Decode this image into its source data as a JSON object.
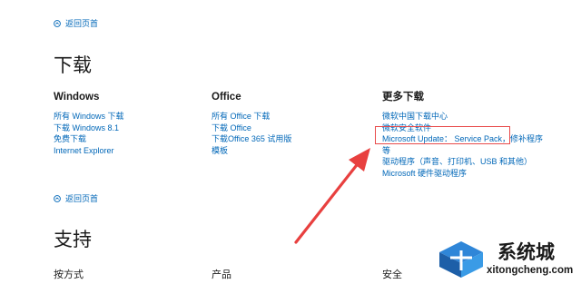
{
  "back_to_top_label": "返回页首",
  "download": {
    "heading": "下载",
    "columns": [
      {
        "title": "Windows",
        "links": [
          "所有 Windows 下载",
          "下载 Windows 8.1",
          "免费下载",
          "Internet Explorer"
        ]
      },
      {
        "title": "Office",
        "links": [
          "所有 Office 下载",
          "下载 Office",
          "下载Office 365 试用版",
          "模板"
        ]
      },
      {
        "title": "更多下载",
        "links": [
          "微软中国下载中心",
          "微软安全软件",
          "Microsoft Update： Service Pack，修补程序等",
          "驱动程序（声音、打印机、USB 和其他）",
          "Microsoft 硬件驱动程序"
        ]
      }
    ]
  },
  "support": {
    "heading": "支持",
    "columns": [
      "按方式",
      "产品",
      "安全"
    ]
  },
  "watermark": {
    "brand": "系统城",
    "url": "xitongcheng.com"
  },
  "colors": {
    "link": "#0067b8",
    "highlight": "#e84a4a",
    "arrow": "#e8403f"
  }
}
